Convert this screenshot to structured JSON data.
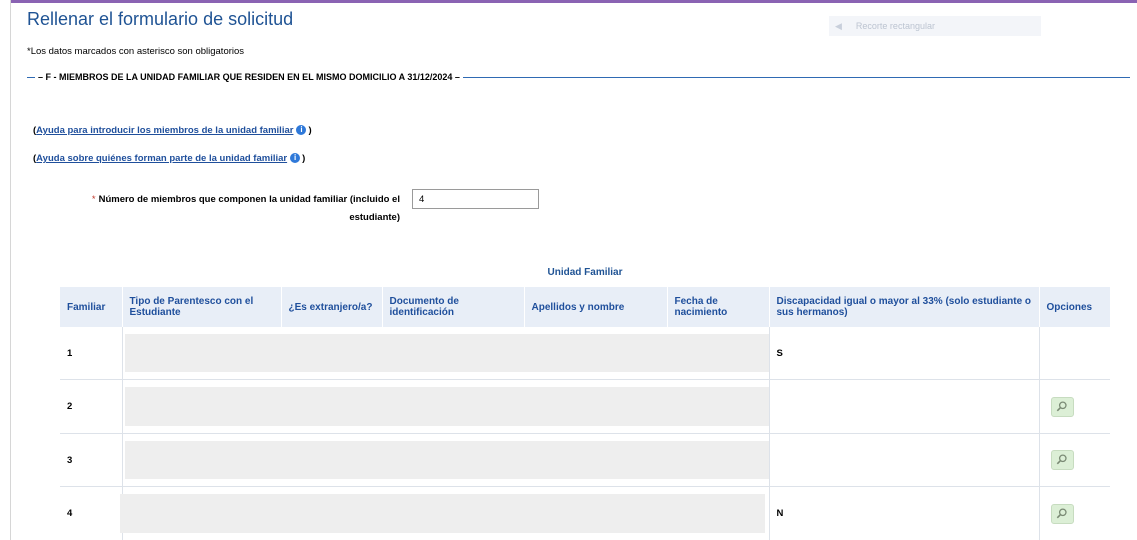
{
  "page": {
    "title": "Rellenar el formulario de solicitud",
    "required_note": "*Los datos marcados con asterisco son obligatorios",
    "ghost_action": {
      "icon": "left-arrow-icon",
      "label": "Recorte rectangular"
    }
  },
  "section": {
    "title": "F - MIEMBROS DE LA UNIDAD FAMILIAR QUE RESIDEN EN EL MISMO DOMICILIO A 31/12/2024"
  },
  "help": {
    "link1": "Ayuda para introducir los miembros de la unidad familiar",
    "link2": "Ayuda sobre quiénes forman parte de la unidad familiar",
    "open_paren": "(",
    "close_paren": ")"
  },
  "members_field": {
    "asterisk": "*",
    "label": "Número de miembros que componen la unidad familiar (incluido el estudiante)",
    "value": "4"
  },
  "table": {
    "caption": "Unidad Familiar",
    "headers": [
      "Familiar",
      "Tipo de Parentesco con el Estudiante",
      "¿Es extranjero/a?",
      "Documento de identificación",
      "Apellidos y nombre",
      "Fecha de nacimiento",
      "Discapacidad igual o mayor al 33% (solo estudiante o sus hermanos)",
      "Opciones"
    ],
    "rows": [
      {
        "familiar": "1",
        "discapacidad": "S",
        "has_view": false
      },
      {
        "familiar": "2",
        "discapacidad": "",
        "has_view": true
      },
      {
        "familiar": "3",
        "discapacidad": "",
        "has_view": true
      },
      {
        "familiar": "4",
        "discapacidad": "N",
        "has_view": true
      }
    ],
    "option_icon": "magnifier-icon"
  },
  "colors": {
    "title": "#1f5394",
    "link": "#1f4f9c",
    "section_line": "#2f6ab3",
    "header_bg": "#e8eef7",
    "view_button_bg": "#dcefd6",
    "top_accent": "#8a63b3"
  }
}
